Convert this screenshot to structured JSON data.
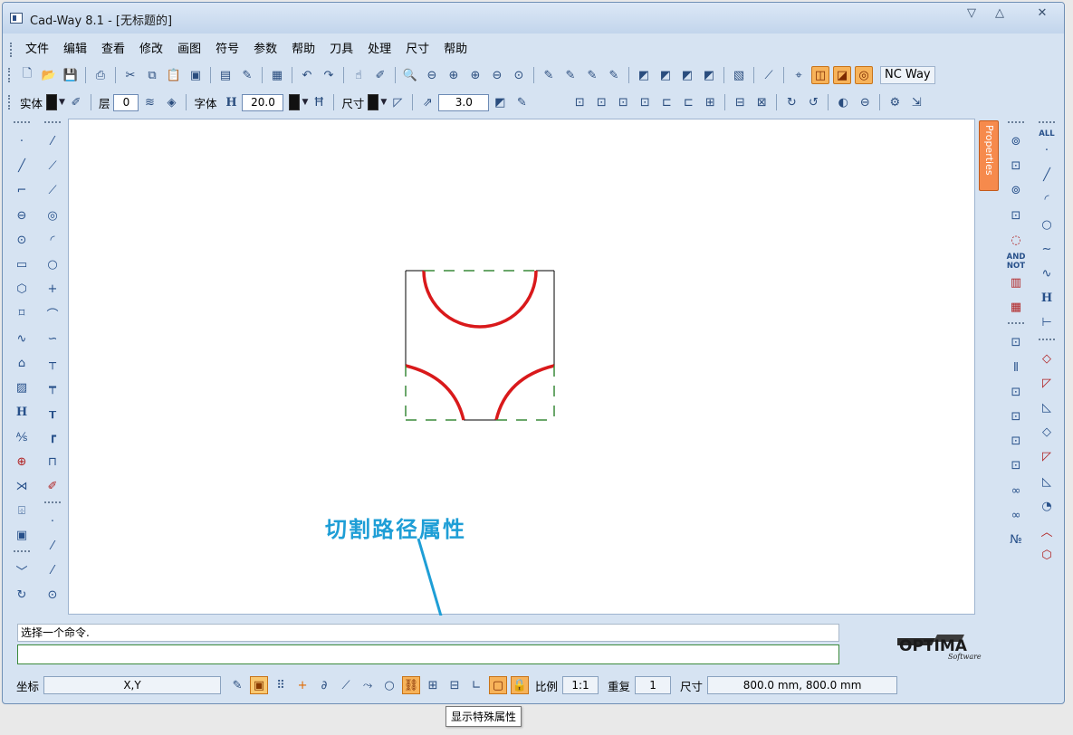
{
  "window": {
    "title": "Cad-Way 8.1 - [无标题的]",
    "controls": {
      "minimize": "▽",
      "maximize": "△",
      "close": "✕"
    }
  },
  "menubar": {
    "items": [
      "文件",
      "编辑",
      "查看",
      "修改",
      "画图",
      "符号",
      "参数",
      "帮助",
      "刀具",
      "处理",
      "尺寸",
      "帮助"
    ]
  },
  "toolbar2": {
    "nc_way": "NC Way"
  },
  "toolbar3": {
    "entity_label": "实体",
    "layer_label": "层",
    "layer_value": "0",
    "font_label": "字体",
    "font_size": "20.0",
    "dim_label": "尺寸",
    "dim_value": "3.0"
  },
  "canvas": {
    "drawing": "square with red cutting arcs and green dashed path segments"
  },
  "properties_tab": {
    "label": "Properties"
  },
  "right_panel": {
    "all_label": "ALL",
    "and_label": "AND",
    "not_label": "NOT",
    "h_label": "H"
  },
  "annotation": {
    "text": "切割路径属性"
  },
  "command": {
    "prompt": "选择一个命令.",
    "input_value": ""
  },
  "logo": {
    "text": "OPTIMA",
    "subtext": "Software"
  },
  "statusbar": {
    "coord_label": "坐标",
    "coord_value": "X,Y",
    "scale_label": "比例",
    "scale_value": "1:1",
    "repeat_label": "重复",
    "repeat_value": "1",
    "size_label": "尺寸",
    "size_value": "800.0 mm, 800.0 mm"
  },
  "tooltip": {
    "text": "显示特殊属性"
  },
  "colors": {
    "accent_blue": "#1e9ed6",
    "cut_red": "#d9191b",
    "path_green": "#3a8a3a",
    "property_orange": "#f68a4c"
  }
}
